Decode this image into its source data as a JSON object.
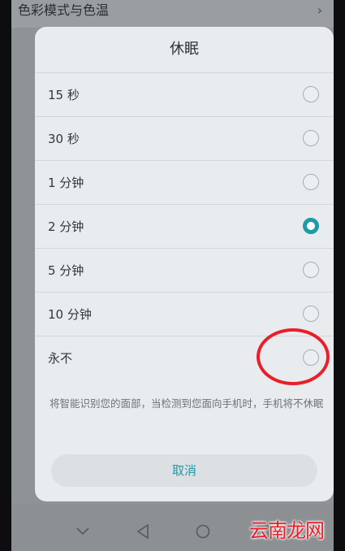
{
  "background_setting": {
    "label": "色彩模式与色温",
    "chevron": "›"
  },
  "dialog": {
    "title": "休眠",
    "options": [
      {
        "label": "15 秒",
        "selected": false
      },
      {
        "label": "30 秒",
        "selected": false
      },
      {
        "label": "1 分钟",
        "selected": false
      },
      {
        "label": "2 分钟",
        "selected": true
      },
      {
        "label": "5 分钟",
        "selected": false
      },
      {
        "label": "10 分钟",
        "selected": false
      },
      {
        "label": "永不",
        "selected": false
      }
    ],
    "hint": "将智能识别您的面部，当检测到您面向手机时，手机将不休眠",
    "cancel_label": "取消"
  },
  "colors": {
    "accent": "#1e9aa8",
    "annotation": "#e8202a"
  },
  "nav": {
    "icons": [
      "chevron-down-icon",
      "back-triangle-icon",
      "home-circle-icon",
      "recents-square-icon"
    ]
  },
  "watermark": {
    "text": "云南龙网"
  }
}
